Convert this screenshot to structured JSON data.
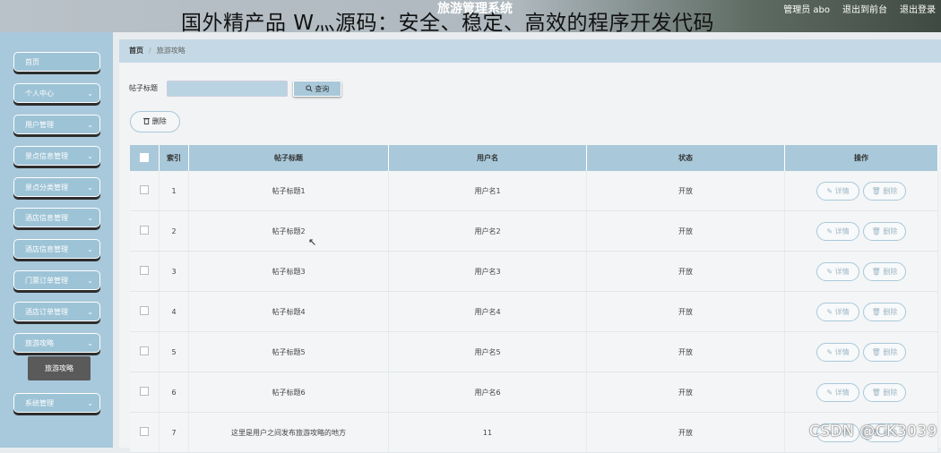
{
  "header": {
    "system_title": "旅游管理系统",
    "overlay_text": "国外精产品 W灬源码：安全、稳定、高效的程序开发代码",
    "links": [
      "管理员 abo",
      "退出到前台",
      "退出登录"
    ]
  },
  "watermark": "CSDN @CK3039",
  "sidebar": {
    "items": [
      {
        "label": "首页",
        "chevron": false
      },
      {
        "label": "个人中心",
        "chevron": true
      },
      {
        "label": "用户管理",
        "chevron": true
      },
      {
        "label": "景点信息管理",
        "chevron": true
      },
      {
        "label": "景点分类管理",
        "chevron": true
      },
      {
        "label": "酒店信息管理",
        "chevron": true
      },
      {
        "label": "酒店信息管理",
        "chevron": true
      },
      {
        "label": "门票订单管理",
        "chevron": true
      },
      {
        "label": "酒店订单管理",
        "chevron": true
      },
      {
        "label": "旅游攻略",
        "chevron": true
      },
      {
        "label": "系统管理",
        "chevron": true
      }
    ],
    "sub_item": "旅游攻略"
  },
  "breadcrumb": {
    "home": "首页",
    "current": "旅游攻略"
  },
  "search": {
    "label": "帖子标题",
    "value": "",
    "button": "查询"
  },
  "actions": {
    "delete": "删除"
  },
  "table": {
    "headers": [
      "索引",
      "帖子标题",
      "用户名",
      "状态",
      "操作"
    ],
    "rows": [
      {
        "index": "1",
        "title": "帖子标题1",
        "user": "用户名1",
        "status": "开放"
      },
      {
        "index": "2",
        "title": "帖子标题2",
        "user": "用户名2",
        "status": "开放"
      },
      {
        "index": "3",
        "title": "帖子标题3",
        "user": "用户名3",
        "status": "开放"
      },
      {
        "index": "4",
        "title": "帖子标题4",
        "user": "用户名4",
        "status": "开放"
      },
      {
        "index": "5",
        "title": "帖子标题5",
        "user": "用户名5",
        "status": "开放"
      },
      {
        "index": "6",
        "title": "帖子标题6",
        "user": "用户名6",
        "status": "开放"
      },
      {
        "index": "7",
        "title": "这里是用户之间发布旅游攻略的地方",
        "user": "11",
        "status": "开放"
      }
    ],
    "row_actions": {
      "detail": "详情",
      "delete": "删除"
    }
  },
  "icons": {
    "search": "search-icon",
    "trash": "trash-icon",
    "edit": "edit-icon",
    "chevron": "chevron-down-icon"
  },
  "colors": {
    "sidebar": "#a8c8db",
    "accent": "#a9c9da",
    "submenu_active": "#5a5a5a"
  }
}
